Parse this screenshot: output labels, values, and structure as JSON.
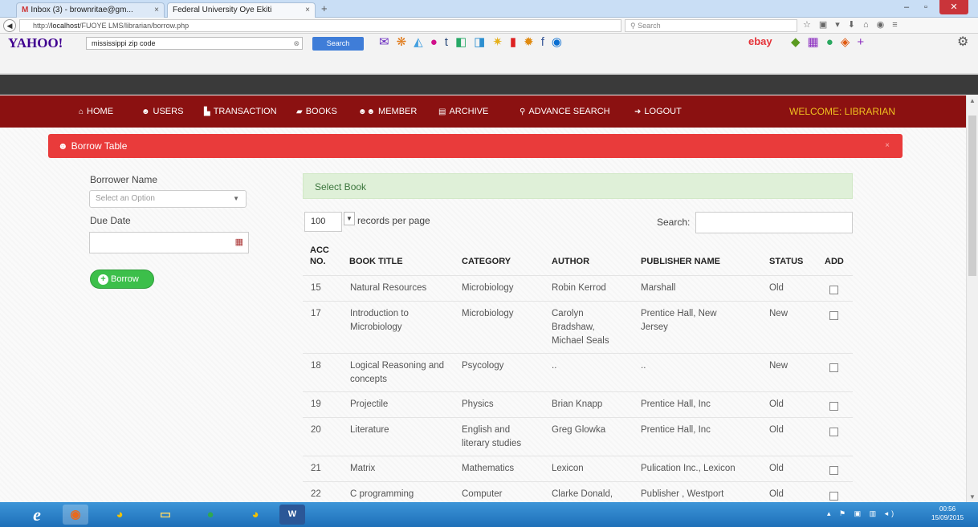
{
  "browser": {
    "tabs": [
      {
        "label": "Inbox (3) - brownritae@gm...",
        "prefix": "M"
      },
      {
        "label": "Federal University Oye Ekiti"
      }
    ],
    "tab_close": "×",
    "new_tab": "+",
    "url_prefix": "http://",
    "url_host": "localhost",
    "url_path": "/FUOYE LMS/librarian/borrow.php",
    "search_placeholder": "Search"
  },
  "toolbar": {
    "logo": "YAHOO!",
    "search_value": "mississippi zip code",
    "search_button": "Search",
    "ebay": "ebay"
  },
  "app": {
    "menu": [
      {
        "icon": "home-icon",
        "label": "HOME"
      },
      {
        "icon": "users-icon",
        "label": "USERS"
      },
      {
        "icon": "transaction-icon",
        "label": "TRANSACTION"
      },
      {
        "icon": "books-icon",
        "label": "BOOKS"
      },
      {
        "icon": "member-icon",
        "label": "MEMBER"
      },
      {
        "icon": "archive-icon",
        "label": "ARCHIVE"
      },
      {
        "icon": "search-icon",
        "label": "ADVANCE SEARCH"
      },
      {
        "icon": "logout-icon",
        "label": "LOGOUT"
      }
    ],
    "welcome": "WELCOME: LIBRARIAN",
    "accent_color": "#8b1111",
    "panel_color": "#e93b3b"
  },
  "panel": {
    "title": "Borrow Table",
    "close": "×"
  },
  "form": {
    "borrower_label": "Borrower Name",
    "borrower_placeholder": "Select an Option",
    "due_date_label": "Due Date",
    "borrow_button": "Borrow"
  },
  "table": {
    "select_book": "Select Book",
    "per_page_value": "100",
    "per_page_text": "records per page",
    "search_label": "Search:",
    "headers": [
      "ACC NO.",
      "BOOK TITLE",
      "CATEGORY",
      "AUTHOR",
      "PUBLISHER NAME",
      "STATUS",
      "ADD"
    ],
    "rows": [
      {
        "acc": "15",
        "title": "Natural Resources",
        "category": "Microbiology",
        "author": "Robin Kerrod",
        "publisher": "Marshall",
        "status": "Old"
      },
      {
        "acc": "17",
        "title": "Introduction to Microbiology",
        "category": "Microbiology",
        "author": "Carolyn Bradshaw, Michael Seals",
        "publisher": "Prentice Hall, New Jersey",
        "status": "New"
      },
      {
        "acc": "18",
        "title": "Logical Reasoning and concepts",
        "category": "Psycology",
        "author": "..",
        "publisher": "..",
        "status": "New"
      },
      {
        "acc": "19",
        "title": "Projectile",
        "category": "Physics",
        "author": "Brian Knapp",
        "publisher": "Prentice Hall, Inc",
        "status": "Old"
      },
      {
        "acc": "20",
        "title": "Literature",
        "category": "English and literary studies",
        "author": "Greg Glowka",
        "publisher": "Prentice Hall, Inc",
        "status": "Old"
      },
      {
        "acc": "21",
        "title": "Matrix",
        "category": "Mathematics",
        "author": "Lexicon",
        "publisher": "Pulication Inc., Lexicon",
        "status": "Old"
      },
      {
        "acc": "22",
        "title": "C programming",
        "category": "Computer",
        "author": "Clarke Donald,",
        "publisher": "Publisher , Westport",
        "status": "Old"
      }
    ]
  },
  "taskbar": {
    "word_label": "W",
    "time": "00:56",
    "date": "15/09/2015"
  }
}
